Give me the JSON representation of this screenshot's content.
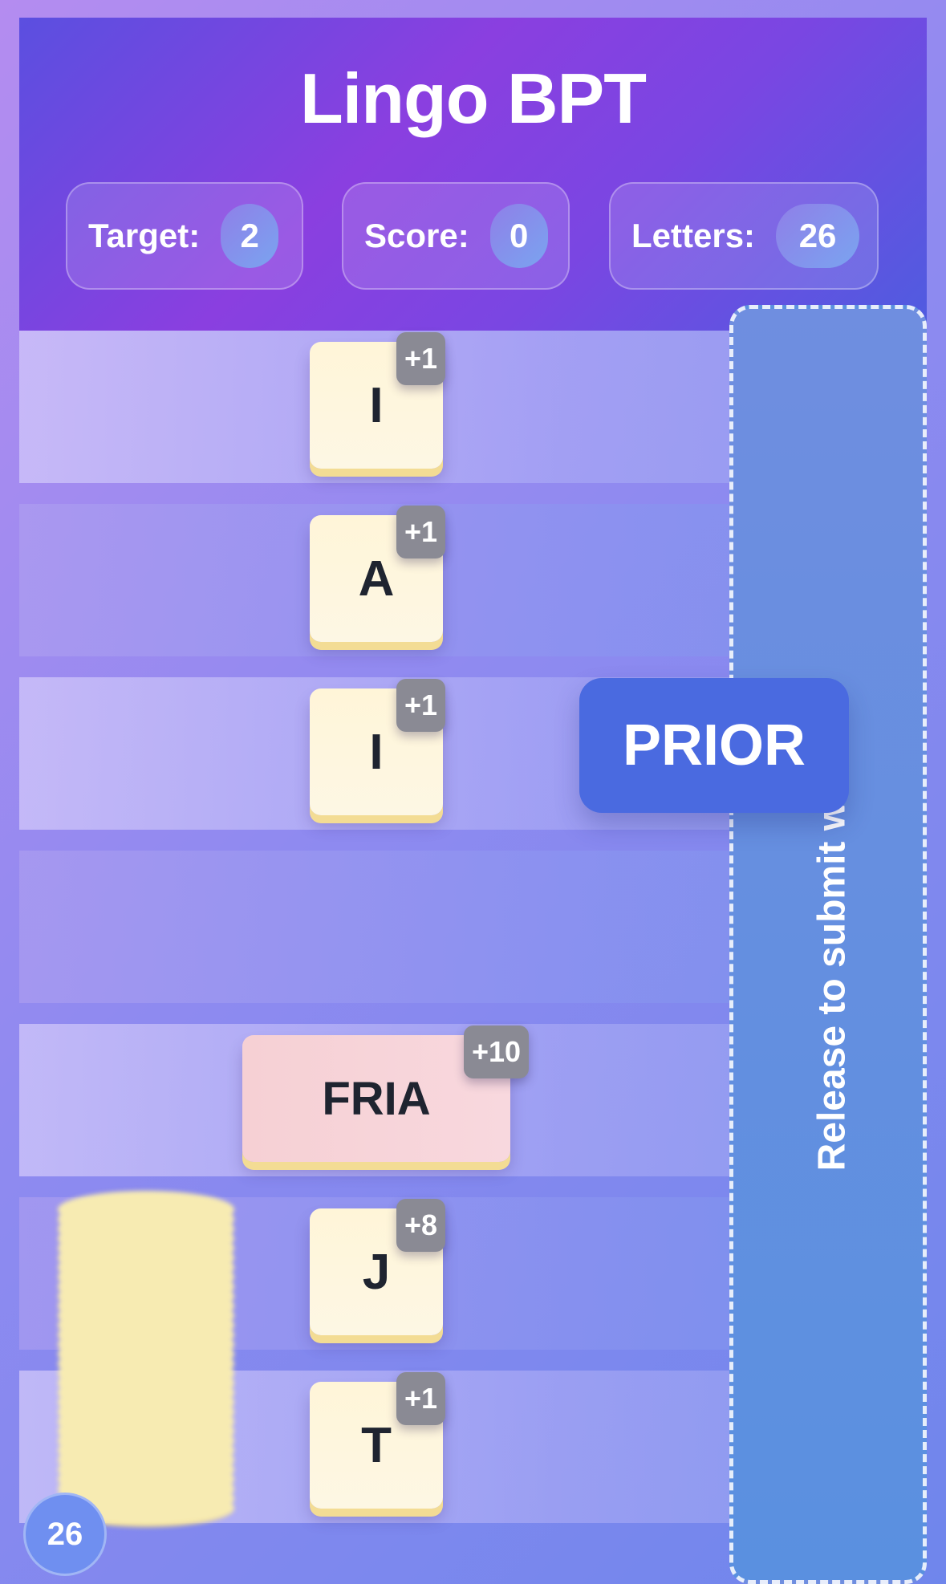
{
  "title": "Lingo BPT",
  "stats": {
    "target_label": "Target:",
    "target_value": "2",
    "score_label": "Score:",
    "score_value": "0",
    "letters_label": "Letters:",
    "letters_value": "26"
  },
  "rows": [
    {
      "tile": "I",
      "points": "+1"
    },
    {
      "tile": "A",
      "points": "+1"
    },
    {
      "tile": "I",
      "points": "+1"
    },
    {
      "tile": "",
      "points": ""
    },
    {
      "tile": "FRIA",
      "points": "+10"
    },
    {
      "tile": "J",
      "points": "+8"
    },
    {
      "tile": "T",
      "points": "+1"
    }
  ],
  "drag_word": "PRIOR",
  "submit_zone_text": "Release to submit word",
  "deck_count": "26"
}
